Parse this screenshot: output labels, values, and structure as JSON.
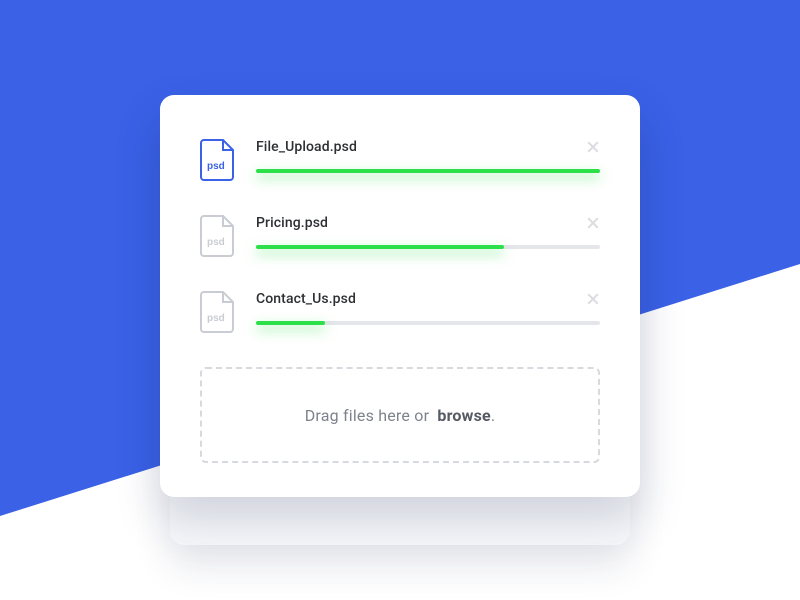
{
  "colors": {
    "accent_blue": "#3a61e6",
    "progress_green": "#2de04a",
    "track_grey": "#e4e6ea",
    "icon_inactive": "#c9ccd2"
  },
  "files": [
    {
      "name": "File_Upload.psd",
      "ext_label": "psd",
      "progress": 100,
      "active": true
    },
    {
      "name": "Pricing.psd",
      "ext_label": "psd",
      "progress": 72,
      "active": false
    },
    {
      "name": "Contact_Us.psd",
      "ext_label": "psd",
      "progress": 20,
      "active": false
    }
  ],
  "dropzone": {
    "prefix": "Drag files here or ",
    "action": "browse",
    "suffix": "."
  }
}
